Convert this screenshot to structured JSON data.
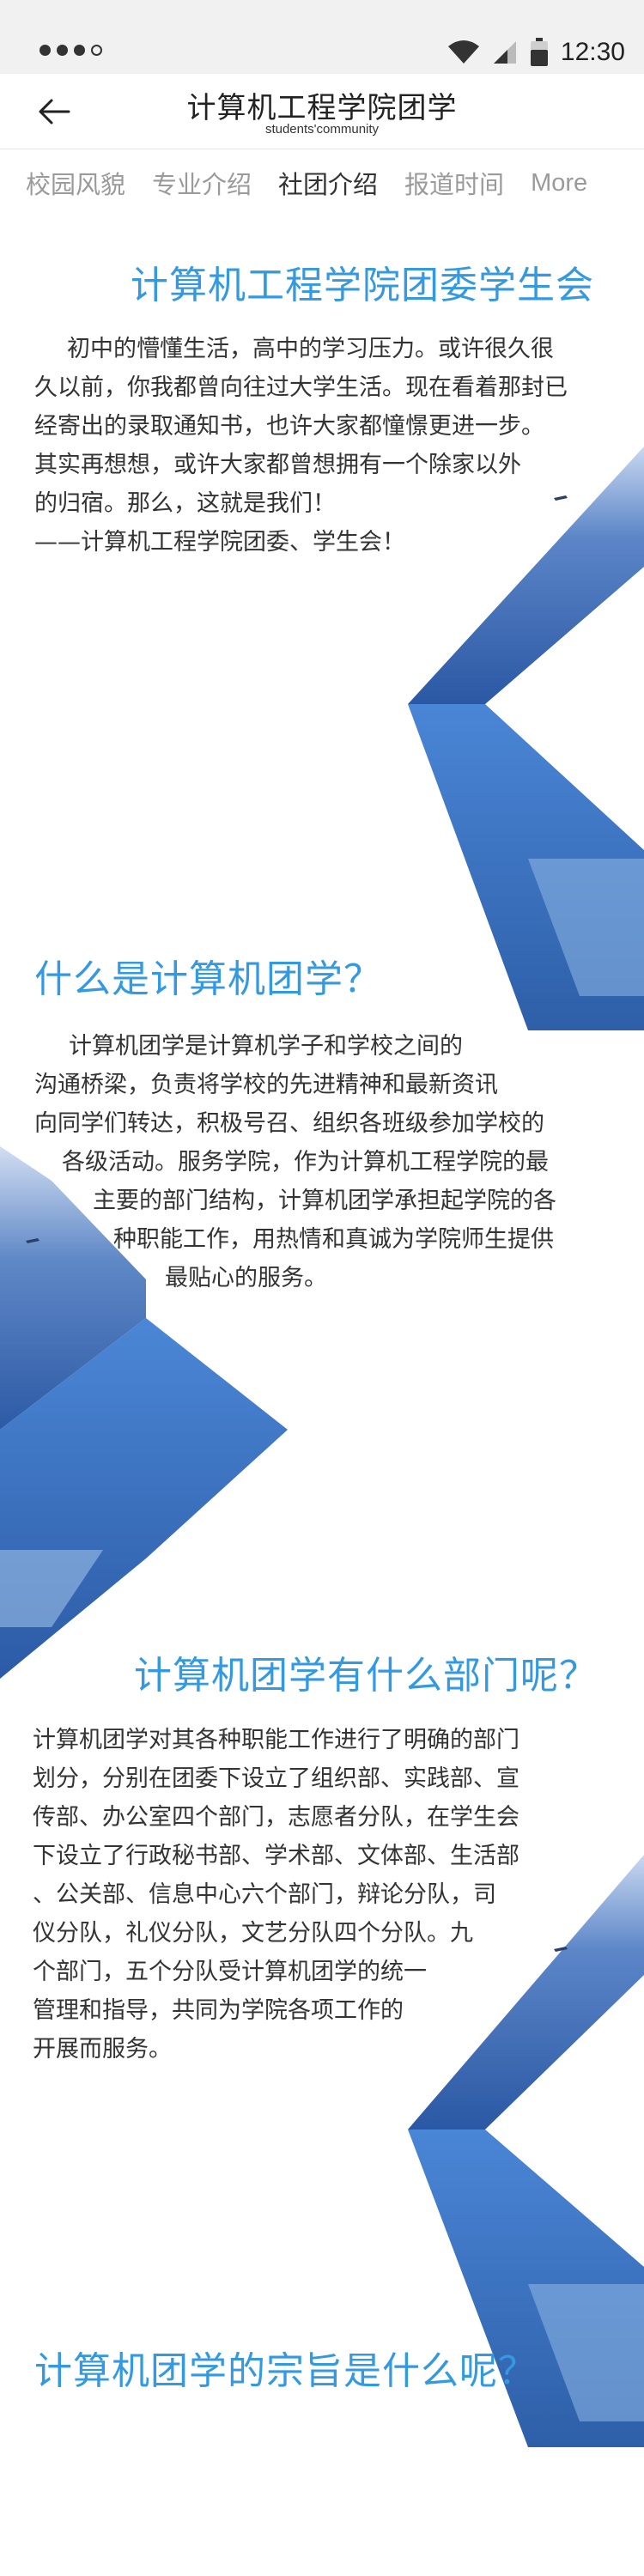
{
  "status_bar": {
    "time": "12:30",
    "icons": [
      "signal-dots-icon",
      "wifi-icon",
      "cellular-icon",
      "battery-icon"
    ]
  },
  "header": {
    "title": "计算机工程学院团学",
    "subtitle": "students'community",
    "back_icon": "back-arrow-icon"
  },
  "tabs": [
    {
      "label": "校园风貌",
      "active": false
    },
    {
      "label": "专业介绍",
      "active": false
    },
    {
      "label": "社团介绍",
      "active": true
    },
    {
      "label": "报道时间",
      "active": false
    },
    {
      "label": "More",
      "active": false
    }
  ],
  "sections": [
    {
      "title": "计算机工程学院团委学生会",
      "lines": [
        "初中的懵懂生活，高中的学习压力。或许很久很",
        "久以前，你我都曾向往过大学生活。现在看着那封已",
        "经寄出的录取通知书，也许大家都憧憬更进一步。",
        "其实再想想，或许大家都曾想拥有一个除家以外",
        "的归宿。那么，这就是我们！",
        "——计算机工程学院团委、学生会！"
      ]
    },
    {
      "title": "什么是计算机团学？",
      "lines": [
        "计算机团学是计算机学子和学校之间的",
        "沟通桥梁，负责将学校的先进精神和最新资讯",
        "向同学们转达，积极号召、组织各班级参加学校的",
        "各级活动。服务学院，作为计算机工程学院的最",
        "主要的部门结构，计算机团学承担起学院的各",
        "种职能工作，用热情和真诚为学院师生提供",
        "最贴心的服务。"
      ]
    },
    {
      "title": "计算机团学有什么部门呢？",
      "lines": [
        "计算机团学对其各种职能工作进行了明确的部门",
        "划分，分别在团委下设立了组织部、实践部、宣",
        "传部、办公室四个部门，志愿者分队，在学生会",
        "下设立了行政秘书部、学术部、文体部、生活部",
        "、公关部、信息中心六个部门，辩论分队，司",
        "仪分队，礼仪分队，文艺分队四个分队。九",
        "个部门，五个分队受计算机团学的统一",
        "管理和指导，共同为学院各项工作的",
        "开展而服务。"
      ]
    },
    {
      "title": "计算机团学的宗旨是什么呢？"
    }
  ],
  "colors": {
    "accent": "#3399e0",
    "text": "#333333",
    "tab_inactive": "#9a9a9a",
    "chevron_dark": "#2c5aa6",
    "chevron_light": "#5f9ae0"
  }
}
